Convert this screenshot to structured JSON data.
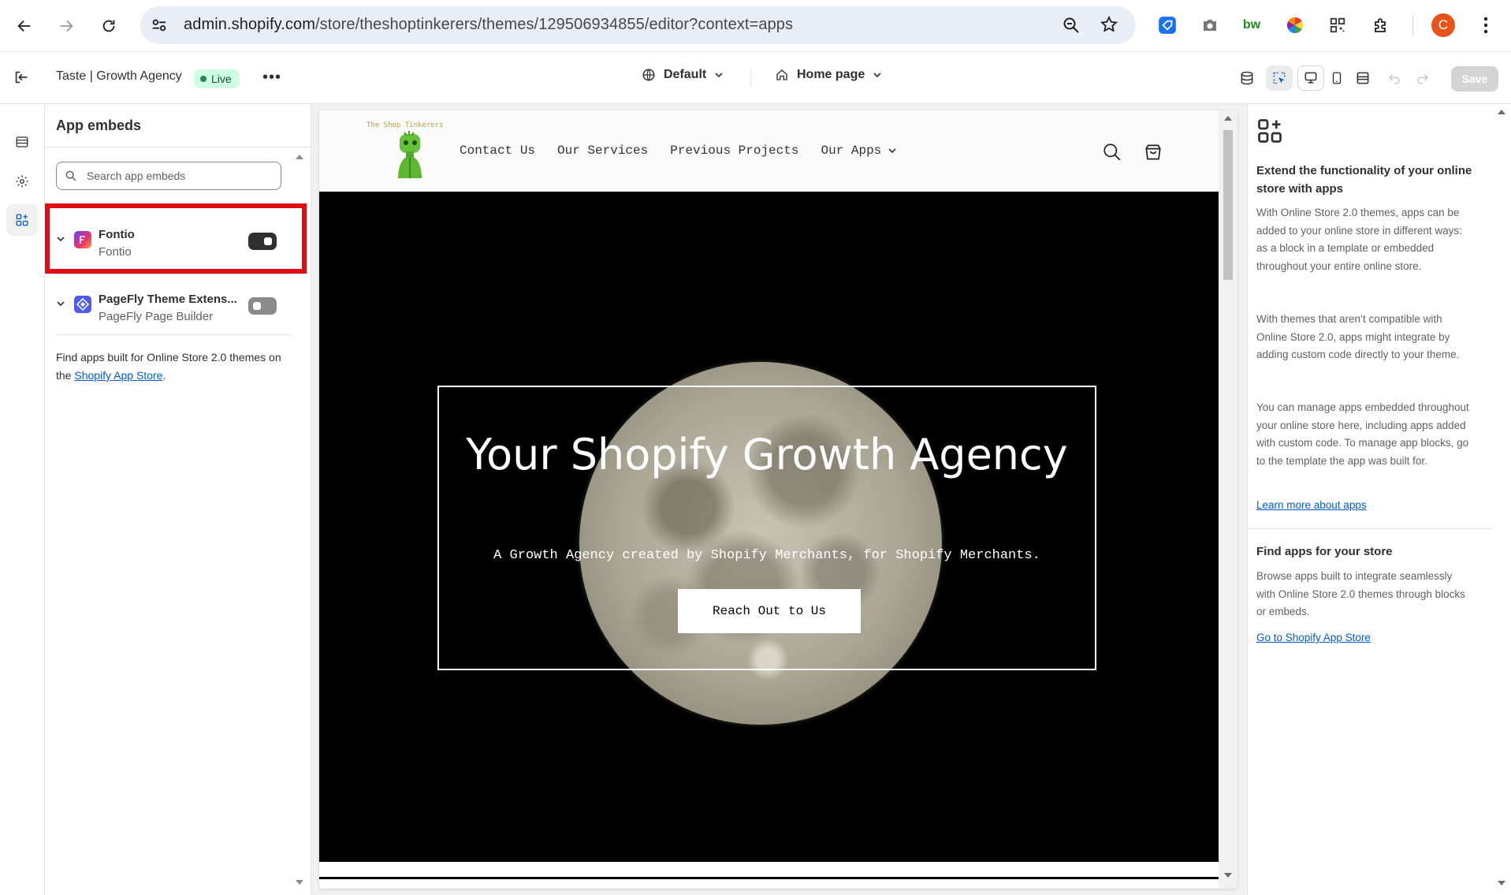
{
  "browser": {
    "url_host": "admin.shopify.com",
    "url_path": "/store/theshoptinkerers/themes/129506934855/editor?context=apps",
    "profile_initial": "C",
    "extensions": [
      "tag-icon",
      "camera-icon",
      "bw-icon",
      "color-wheel-icon",
      "qr-icon",
      "puzzle-icon"
    ]
  },
  "topbar": {
    "theme_name": "Taste | Growth Agency",
    "live_label": "Live",
    "more_label": "•••",
    "context_select": "Default",
    "page_select": "Home page",
    "save_label": "Save"
  },
  "sidebar": {
    "title": "App embeds",
    "search_placeholder": "Search app embeds",
    "embeds": [
      {
        "name": "Fontio",
        "subtitle": "Fontio",
        "enabled": true
      },
      {
        "name": "PageFly Theme Extens...",
        "subtitle": "PageFly Page Builder",
        "enabled": false
      }
    ],
    "find_text": "Find apps built for Online Store 2.0 themes on the",
    "find_link": "Shopify App Store",
    "find_suffix": "."
  },
  "store": {
    "logo_text": "The Shop Tinkerers",
    "nav": [
      "Contact Us",
      "Our Services",
      "Previous Projects",
      "Our Apps"
    ],
    "hero_title": "Your Shopify Growth Agency",
    "hero_subtitle": "A Growth Agency created by Shopify Merchants, for Shopify Merchants.",
    "hero_button": "Reach Out to Us"
  },
  "right_panel": {
    "heading1": "Extend the functionality of your online store with apps",
    "para1": "With Online Store 2.0 themes, apps can be added to your online store in different ways: as a block in a template or embedded throughout your entire online store.",
    "para2": "With themes that aren’t compatible with Online Store 2.0, apps might integrate by adding custom code directly to your theme.",
    "para3": "You can manage apps embedded throughout your online store here, including apps added with custom code. To manage app blocks, go to the template the app was built for.",
    "link1": "Learn more about apps",
    "heading2": "Find apps for your store",
    "para4": "Browse apps built to integrate seamlessly with Online Store 2.0 themes through blocks or embeds.",
    "link2": "Go to Shopify App Store"
  },
  "colors": {
    "highlight": "#e10d15",
    "live_badge": "#cdfee1",
    "link": "#005bd3",
    "avatar": "#e8531a"
  }
}
